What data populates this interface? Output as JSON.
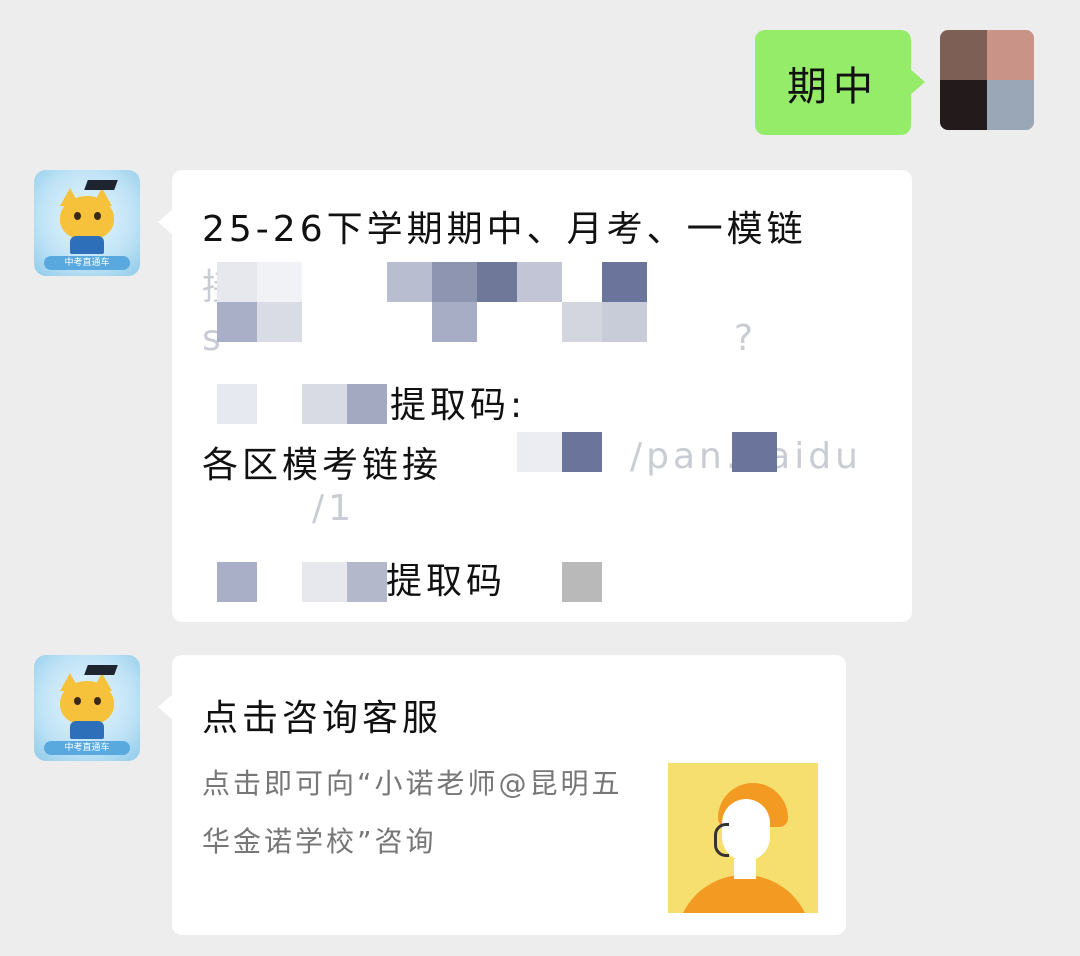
{
  "user_message": {
    "text": "期中"
  },
  "bot_message": {
    "line1": "25-26下学期期中、月考、一模链",
    "line2_partial": "接",
    "line3_partial": "s",
    "line3_end": "?",
    "code_label_1": "提取码:",
    "district_label": "各区模考链接",
    "district_url_partial": "/pan.baidu",
    "line6_partial": "/1",
    "code_label_2": "提取码"
  },
  "card_message": {
    "title": "点击咨询客服",
    "description": "点击即可向“小诺老师@昆明五华金诺学校”咨询",
    "thumbnail_icon": "customer-service-agent-icon"
  },
  "bot_avatar": {
    "banner_text": "中考直通车"
  },
  "colors": {
    "background": "#ededed",
    "user_bubble": "#95ec69",
    "bot_bubble": "#ffffff",
    "thumb_bg": "#f6df6e",
    "thumb_accent": "#f39a22"
  }
}
